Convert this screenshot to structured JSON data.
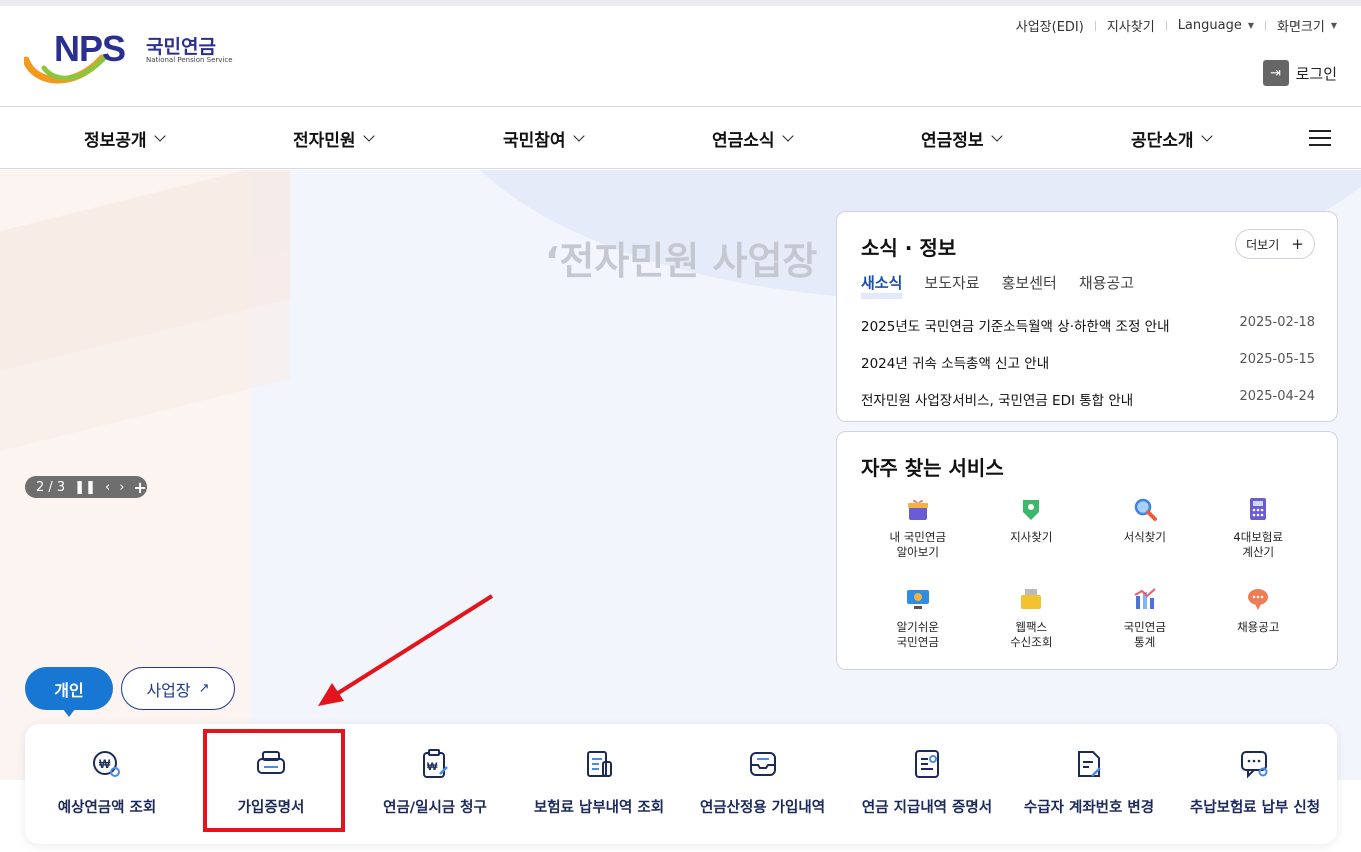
{
  "header": {
    "logo_text": "NPS",
    "logo_kor": "국민연금",
    "logo_eng": "National Pension Service",
    "util_links": [
      "사업장(EDI)",
      "지사찾기",
      "Language",
      "화면크기"
    ],
    "login_label": "로그인"
  },
  "gnb": {
    "items": [
      "정보공개",
      "전자민원",
      "국민참여",
      "연금소식",
      "연금정보",
      "공단소개"
    ]
  },
  "hero": {
    "title": "‘전자민원 사업장",
    "pager": "2 / 3"
  },
  "tabs": {
    "personal": "개인",
    "business": "사업장"
  },
  "news": {
    "title": "소식 · 정보",
    "more": "더보기",
    "tabs": [
      "새소식",
      "보도자료",
      "홍보센터",
      "채용공고"
    ],
    "items": [
      {
        "title": "2025년도 국민연금 기준소득월액 상·하한액 조정 안내",
        "date": "2025-02-18"
      },
      {
        "title": "2024년 귀속 소득총액 신고 안내",
        "date": "2025-05-15"
      },
      {
        "title": "전자민원 사업장서비스, 국민연금 EDI 통합 안내",
        "date": "2025-04-24"
      }
    ]
  },
  "services": {
    "title": "자주 찾는 서비스",
    "items": [
      {
        "l1": "내 국민연금",
        "l2": "알아보기",
        "icon": "gift-icon",
        "color": "#f2b33d"
      },
      {
        "l1": "지사찾기",
        "l2": "",
        "icon": "map-pin-icon",
        "color": "#3bb86a"
      },
      {
        "l1": "서식찾기",
        "l2": "",
        "icon": "magnifier-icon",
        "color": "#3f82e8"
      },
      {
        "l1": "4대보험료",
        "l2": "계산기",
        "icon": "calculator-icon",
        "color": "#6a5cd6"
      },
      {
        "l1": "알기쉬운",
        "l2": "국민연금",
        "icon": "monitor-icon",
        "color": "#2f8ee3"
      },
      {
        "l1": "웹팩스",
        "l2": "수신조회",
        "icon": "fax-icon",
        "color": "#f3c230"
      },
      {
        "l1": "국민연금",
        "l2": "통계",
        "icon": "chart-icon",
        "color": "#4a73e0"
      },
      {
        "l1": "채용공고",
        "l2": "",
        "icon": "chat-bubble-icon",
        "color": "#ee7b52"
      }
    ]
  },
  "quick": {
    "items": [
      {
        "label": "예상연금액 조회",
        "icon": "pension-estimate-icon"
      },
      {
        "label": "가입증명서",
        "icon": "printer-icon"
      },
      {
        "label": "연금/일시금 청구",
        "icon": "claim-clipboard-icon"
      },
      {
        "label": "보험료 납부내역 조회",
        "icon": "payment-history-icon"
      },
      {
        "label": "연금산정용 가입내역",
        "icon": "inbox-icon"
      },
      {
        "label": "연금 지급내역 증명서",
        "icon": "certificate-icon"
      },
      {
        "label": "수급자 계좌번호 변경",
        "icon": "account-edit-icon"
      },
      {
        "label": "추납보험료 납부 신청",
        "icon": "chat-search-icon"
      }
    ]
  },
  "colors": {
    "brand": "#2b2f8f",
    "accent": "#1877d2",
    "highlight": "#e3141b"
  }
}
